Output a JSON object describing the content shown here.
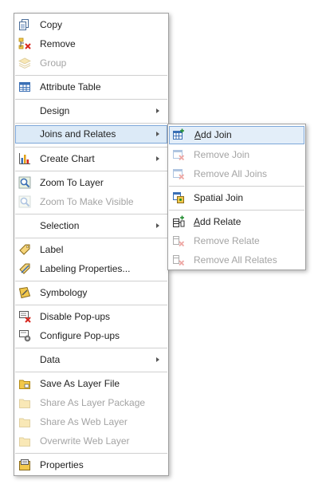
{
  "main_menu": {
    "copy": "Copy",
    "remove": "Remove",
    "group": "Group",
    "attribute_table": "Attribute Table",
    "design": "Design",
    "joins_and_relates": "Joins and Relates",
    "create_chart": "Create Chart",
    "zoom_to_layer": "Zoom To Layer",
    "zoom_to_make_visible": "Zoom To Make Visible",
    "selection": "Selection",
    "label": "Label",
    "labeling_properties": "Labeling Properties...",
    "symbology": "Symbology",
    "disable_popups": "Disable Pop-ups",
    "configure_popups": "Configure Pop-ups",
    "data": "Data",
    "save_as_layer_file": "Save As Layer File",
    "share_as_layer_package": "Share As Layer Package",
    "share_as_web_layer": "Share As Web Layer",
    "overwrite_web_layer": "Overwrite Web Layer",
    "properties": "Properties"
  },
  "sub_menu": {
    "add_join_accel": "A",
    "add_join_rest": "dd Join",
    "remove_join": "Remove Join",
    "remove_all_joins": "Remove All Joins",
    "spatial_join": "Spatial Join",
    "add_relate_accel": "A",
    "add_relate_rest": "dd Relate",
    "remove_relate": "Remove Relate",
    "remove_all_relates": "Remove All Relates"
  },
  "colors": {
    "highlight_fill": "#e3eef9",
    "highlight_border": "#7da7d9",
    "disabled_text": "#a4a4a4",
    "table_icon_blue": "#3a6fb5",
    "remove_red": "#d7261e",
    "folder_yellow": "#f2c84b"
  },
  "icons": [
    "copy-icon",
    "remove-icon",
    "group-icon",
    "table-icon",
    "chart-icon",
    "zoom-icon",
    "zoom-visible-icon",
    "label-icon",
    "labeling-properties-icon",
    "symbology-icon",
    "disable-popups-icon",
    "configure-popups-icon",
    "layer-file-icon",
    "layer-package-icon",
    "web-layer-icon",
    "overwrite-web-layer-icon",
    "properties-icon",
    "add-join-icon",
    "remove-join-icon",
    "remove-all-joins-icon",
    "spatial-join-icon",
    "add-relate-icon",
    "remove-relate-icon",
    "remove-all-relates-icon"
  ]
}
